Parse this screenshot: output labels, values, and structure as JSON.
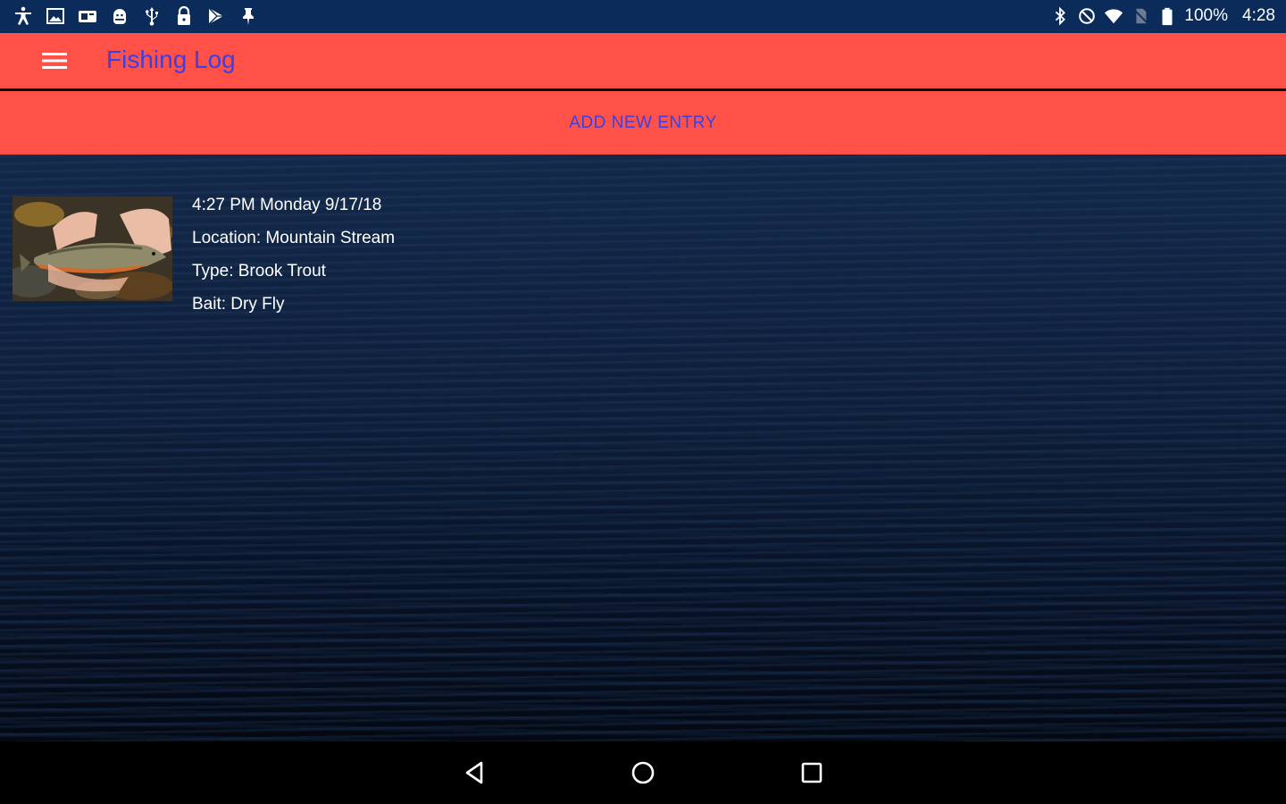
{
  "status_bar": {
    "notification_icons": [
      "accessibility-icon",
      "image-icon",
      "screenshot-icon",
      "android-debug-icon",
      "usb-icon",
      "lock-icon",
      "play-store-icon",
      "pin-icon"
    ],
    "system_icons": [
      "bluetooth-icon",
      "do-not-disturb-icon",
      "wifi-icon",
      "no-sim-icon",
      "battery-icon"
    ],
    "battery": "100%",
    "time": "4:28"
  },
  "app_bar": {
    "menu_icon": "menu-icon",
    "title": "Fishing Log"
  },
  "actions": {
    "add_entry_label": "ADD NEW ENTRY"
  },
  "entries": [
    {
      "timestamp": "4:27 PM Monday 9/17/18",
      "location": "Location: Mountain Stream",
      "type": "Type: Brook Trout",
      "bait": "Bait: Dry Fly",
      "image": "brook-trout-photo"
    }
  ],
  "nav_bar": {
    "back": "back-icon",
    "home": "home-icon",
    "recents": "recents-icon"
  },
  "colors": {
    "status_bar": "#0b2b5a",
    "accent": "#ff5147",
    "title_text": "#3d3fe0",
    "entry_text": "#ffffff"
  }
}
